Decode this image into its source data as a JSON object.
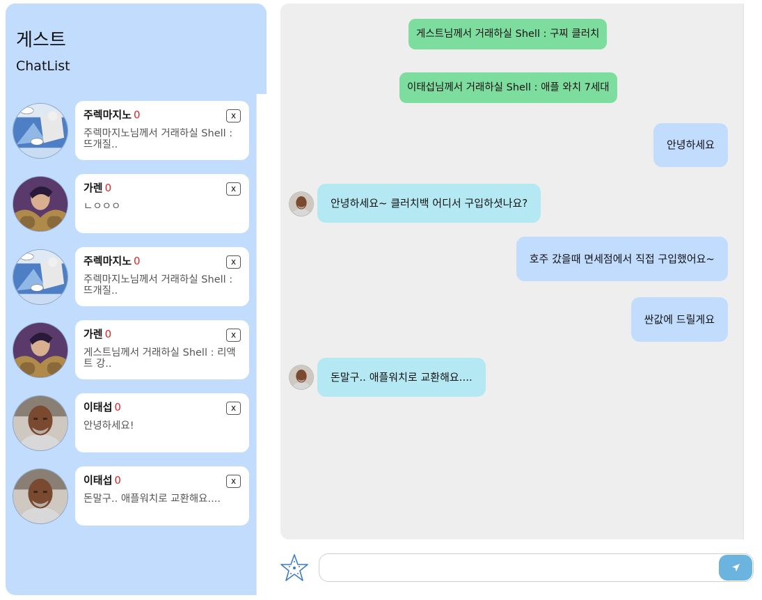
{
  "sidebar": {
    "user_name": "게스트",
    "title": "ChatList",
    "chats": [
      {
        "name": "주렉마지노",
        "unread": "0",
        "preview": "주렉마지노님께서 거래하실 Shell : 뜨개질..",
        "avatar": "comic-avatar"
      },
      {
        "name": "가렌",
        "unread": "0",
        "preview": "ㄴㅇㅇㅇ",
        "avatar": "warrior-avatar"
      },
      {
        "name": "주렉마지노",
        "unread": "0",
        "preview": "주렉마지노님께서 거래하실 Shell : 뜨개질..",
        "avatar": "comic-avatar"
      },
      {
        "name": "가렌",
        "unread": "0",
        "preview": "게스트님께서 거래하실 Shell : 리액트 강..",
        "avatar": "warrior-avatar"
      },
      {
        "name": "이태섭",
        "unread": "0",
        "preview": "안녕하세요!",
        "avatar": "man-avatar"
      },
      {
        "name": "이태섭",
        "unread": "0",
        "preview": "돈말구.. 애플워치로 교환해요....",
        "avatar": "man-avatar"
      }
    ],
    "close_label": "x"
  },
  "chat": {
    "system_messages": [
      "게스트님께서 거래하실 Shell : 구찌 클러치",
      "이태섭님께서 거래하실 Shell : 애플 와치 7세대"
    ],
    "messages": [
      {
        "from": "me",
        "text": "안녕하세요"
      },
      {
        "from": "them",
        "text": "안녕하세요~ 클러치백 어디서 구입하셧나요?"
      },
      {
        "from": "me",
        "text": "호주 갔을때 면세점에서 직접 구입했어요~"
      },
      {
        "from": "me",
        "text": "싼값에 드릴게요"
      },
      {
        "from": "them",
        "text": "돈말구.. 애플워치로 교환해요...."
      }
    ]
  },
  "input": {
    "value": "",
    "placeholder": ""
  },
  "icons": {
    "emoji": "starfish-icon",
    "send": "send-icon"
  },
  "colors": {
    "sidebar_bg": "#c2dcfd",
    "system_msg": "#7ddd9f",
    "my_bubble": "#c2dcfd",
    "their_bubble": "#b4e9f3",
    "unread": "#e02424",
    "send_button": "#6ab4df"
  }
}
